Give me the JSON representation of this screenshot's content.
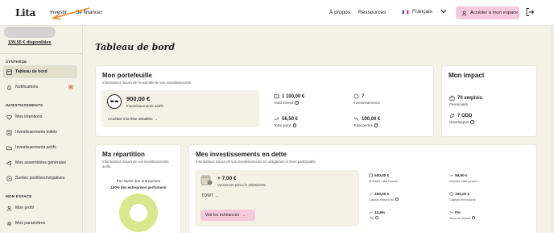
{
  "nav": {
    "logo": "Lita",
    "investir": "Investir",
    "financer": "Se financer",
    "apropos": "À propos",
    "ressources": "Ressources",
    "language": "Français",
    "access_button": "Accéder à mon espace",
    "flag_colors": [
      "#2a4fc1",
      "#ffffff",
      "#e23b3b"
    ]
  },
  "sidebar": {
    "balance": "139,55 € disponibles",
    "synthese_title": "SYNTHÈSE",
    "dashboard": "Tableau de bord",
    "notifications": "Notifications",
    "notifications_badge": "2",
    "investissements_title": "INVESTISSEMENTS",
    "items": [
      {
        "label": "Mes intentions",
        "icon": "heart-icon"
      },
      {
        "label": "Investissements initiés",
        "icon": "list-icon"
      },
      {
        "label": "Investissements actifs",
        "icon": "folder-icon"
      },
      {
        "label": "Mes assemblées générales",
        "icon": "megaphone-icon"
      },
      {
        "label": "Sorties positives/négatives",
        "icon": "exit-icon"
      }
    ],
    "mon_espace_title": "MON ESPACE",
    "profile": "Mon profil",
    "settings": "Mes paramètres"
  },
  "page_title": "Tableau de bord",
  "portfolio": {
    "title": "Mon portefeuille",
    "subtitle": "Informations issues de l'ensemble de vos investissements",
    "amount": "900,00 €",
    "amount_label": "Investissements actifs",
    "details_link": "Accéder à la liste détaillée",
    "total_invested_value": "1 100,00 €",
    "total_invested_label": "Total investi",
    "investments_count": "7",
    "investments_label": "Investissements",
    "gains_value": "56,50 €",
    "gains_label": "Total gains",
    "losses_value": "100,00 €",
    "losses_label": "Total pertes"
  },
  "impact": {
    "title": "Mon impact",
    "jobs_value": "70 emplois",
    "jobs_label": "Pérennisés",
    "odd_value": "7 ODD",
    "odd_label": "Développés"
  },
  "repartition": {
    "title": "Ma répartition",
    "subtitle": "Informations issues de vos investissements actifs.",
    "category": "Par santé des entreprises",
    "category_detail": "100% des entreprises performent",
    "donut_color": "#d9e88f"
  },
  "debt": {
    "title": "Mes investissements en dette",
    "subtitle": "Informations issues de vos investissements en obligations et titres participatifs.",
    "amount": "+ 7,00 €",
    "payment_label": "Versement prévu le 30/06/2025",
    "code": "TOWT",
    "schedule_button": "Voir les échéances",
    "stats": [
      {
        "value": "500,00 €",
        "label": "Montant total investi"
      },
      {
        "value": "56,50 €",
        "label": "Intérêts total perçus"
      },
      {
        "value": "400,00 €",
        "label": "Capital restant dû"
      },
      {
        "value": "100,00 €",
        "label": "Capital remboursé"
      },
      {
        "value": "10,6%",
        "label": "TRI"
      },
      {
        "value": "0%",
        "label": "Taux de défaut"
      }
    ]
  },
  "colors": {
    "background": "#f4f1e6",
    "accent_pink": "#f7c9dc",
    "arrow": "#f08a2c"
  }
}
